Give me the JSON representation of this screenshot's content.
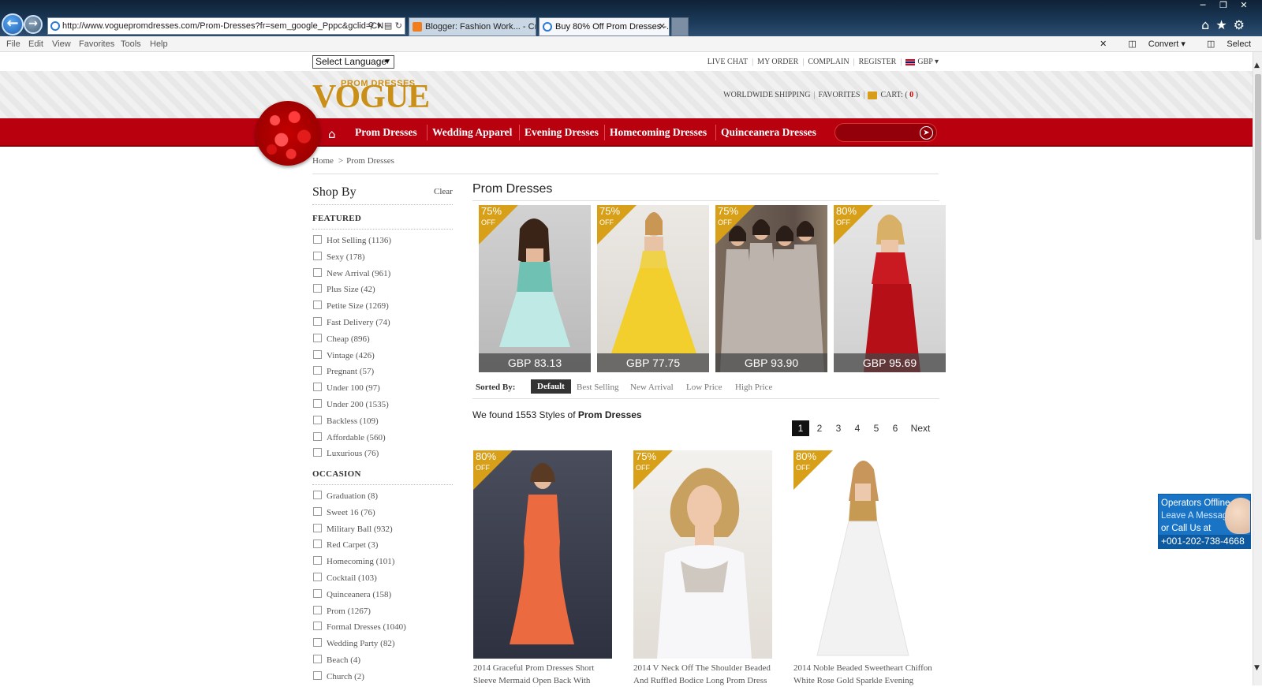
{
  "browser": {
    "url": "http://www.voguepromdresses.com/Prom-Dresses?fr=sem_google_Pppc&gclid=CN",
    "tabs": [
      {
        "label": "Blogger: Fashion Work... - Crea..."
      },
      {
        "label": "Buy 80% Off Prom Dresses -..."
      }
    ],
    "menu": [
      "File",
      "Edit",
      "View",
      "Favorites",
      "Tools",
      "Help"
    ],
    "toolbar_right": {
      "convert": "Convert",
      "select": "Select"
    }
  },
  "site": {
    "language_select": "Select Language",
    "top_links": [
      "LIVE CHAT",
      "MY ORDER",
      "COMPLAIN",
      "REGISTER"
    ],
    "currency": "GBP",
    "logo_big": "VOGUE",
    "logo_small": "PROM DRESSES",
    "header_links": {
      "shipping": "WORLDWIDE SHIPPING",
      "favorites": "FAVORITES",
      "cart": "CART: (",
      "cart_count": "0",
      "cart_close": ")"
    },
    "nav": [
      "Prom Dresses",
      "Wedding Apparel",
      "Evening Dresses",
      "Homecoming Dresses",
      "Quinceanera Dresses"
    ]
  },
  "breadcrumb": {
    "home": "Home",
    "sep": ">",
    "current": "Prom Dresses"
  },
  "sidebar": {
    "title": "Shop By",
    "clear": "Clear",
    "featured_heading": "FEATURED",
    "featured": [
      "Hot Selling (1136)",
      "Sexy (178)",
      "New Arrival (961)",
      "Plus Size (42)",
      "Petite Size (1269)",
      "Fast Delivery (74)",
      "Cheap (896)",
      "Vintage (426)",
      "Pregnant (57)",
      "Under 100 (97)",
      "Under 200 (1535)",
      "Backless (109)",
      "Affordable (560)",
      "Luxurious (76)"
    ],
    "occasion_heading": "OCCASION",
    "occasion": [
      "Graduation (8)",
      "Sweet 16 (76)",
      "Military Ball (932)",
      "Red Carpet (3)",
      "Homecoming (101)",
      "Cocktail (103)",
      "Quinceanera (158)",
      "Prom (1267)",
      "Formal Dresses (1040)",
      "Wedding Party (82)",
      "Beach (4)",
      "Church (2)"
    ]
  },
  "main": {
    "title": "Prom Dresses",
    "featured_products": [
      {
        "discount": "75%",
        "off": "OFF",
        "price": "GBP 83.13"
      },
      {
        "discount": "75%",
        "off": "OFF",
        "price": "GBP 77.75"
      },
      {
        "discount": "75%",
        "off": "OFF",
        "price": "GBP 93.90"
      },
      {
        "discount": "80%",
        "off": "OFF",
        "price": "GBP 95.69"
      }
    ],
    "sorted_by_label": "Sorted By:",
    "sort_options": [
      "Default",
      "Best Selling",
      "New Arrival",
      "Low Price",
      "High Price"
    ],
    "found_prefix": "We found 1553 Styles of",
    "found_category": "Prom Dresses",
    "pages": [
      "1",
      "2",
      "3",
      "4",
      "5",
      "6"
    ],
    "next": "Next",
    "products": [
      {
        "discount": "80%",
        "off": "OFF",
        "title_1": "2014 Graceful Prom Dresses Short",
        "title_2": "Sleeve Mermaid Open Back With"
      },
      {
        "discount": "75%",
        "off": "OFF",
        "title_1": "2014 V Neck Off The Shoulder Beaded",
        "title_2": "And Ruffled Bodice Long Prom Dress"
      },
      {
        "discount": "80%",
        "off": "OFF",
        "title_1": "2014 Noble Beaded Sweetheart Chiffon",
        "title_2": "White Rose Gold Sparkle Evening"
      }
    ]
  },
  "chat": {
    "line1": "Operators Offline",
    "line2": "Leave A Message",
    "line3": "or Call Us at",
    "phone": "+001-202-738-4668"
  },
  "colors": {
    "brand_red": "#b8000f",
    "gold": "#c98f17",
    "badge": "#d8a019",
    "chat_blue": "#1a74c6"
  }
}
